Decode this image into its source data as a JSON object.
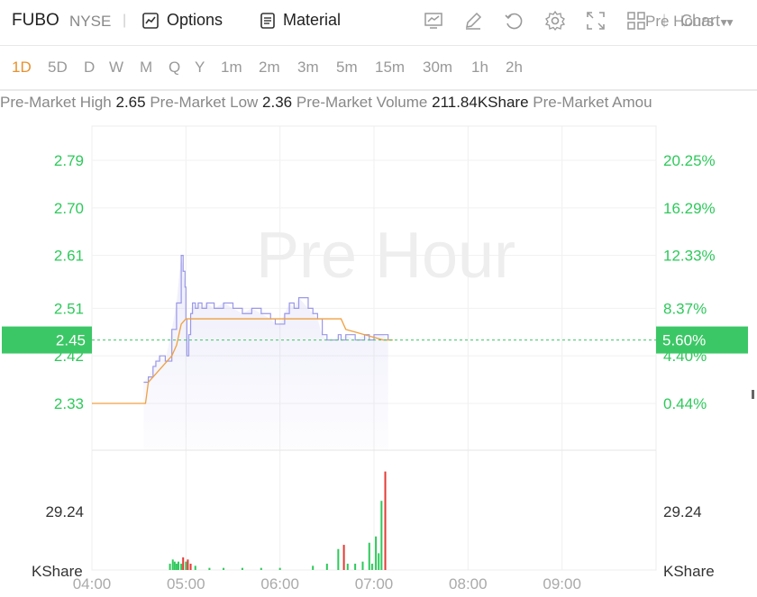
{
  "header": {
    "symbol": "FUBO",
    "exchange": "NYSE",
    "options_label": "Options",
    "material_label": "Material",
    "chart_select_label": "Chart",
    "icons": [
      "line-chart-icon",
      "pen-icon",
      "undo-icon",
      "settings-icon",
      "fullscreen-icon",
      "grid-layout-icon"
    ]
  },
  "periods": [
    "1D",
    "5D",
    "D",
    "W",
    "M",
    "Q",
    "Y",
    "1m",
    "2m",
    "3m",
    "5m",
    "15m",
    "30m",
    "1h",
    "2h"
  ],
  "active_period": "1D",
  "session_select_label": "Pre Hours",
  "stats": [
    {
      "label": "Pre-Market High",
      "value": "2.65"
    },
    {
      "label": "Pre-Market Low",
      "value": "2.36"
    },
    {
      "label": "Pre-Market Volume",
      "value": "211.84KShare"
    },
    {
      "label": "Pre-Market Amou",
      "value": ""
    }
  ],
  "colors": {
    "up": "#2ec95b",
    "down": "#e53935",
    "price_line": "#9a98e8",
    "avg_line": "#f0a040",
    "current": "#3cc766"
  },
  "chart_data": {
    "type": "line",
    "watermark": "Pre Hour",
    "x_ticks": [
      "04:00",
      "05:00",
      "06:00",
      "07:00",
      "08:00",
      "09:00"
    ],
    "x_range_hours": [
      4.0,
      10.0
    ],
    "price_ticks": [
      "2.79",
      "2.70",
      "2.61",
      "2.51",
      "2.42",
      "2.33"
    ],
    "price_tick_values": [
      2.79,
      2.7,
      2.61,
      2.51,
      2.42,
      2.33
    ],
    "pct_ticks": [
      "20.25%",
      "16.29%",
      "12.33%",
      "8.37%",
      "4.40%",
      "0.44%"
    ],
    "ylim": [
      2.3,
      2.82
    ],
    "current_price": "2.45",
    "current_pct": "5.60%",
    "current_value": 2.45,
    "price_series": {
      "x": [
        4.55,
        4.6,
        4.65,
        4.68,
        4.72,
        4.78,
        4.85,
        4.9,
        4.95,
        4.97,
        4.99,
        5.0,
        5.01,
        5.03,
        5.05,
        5.07,
        5.1,
        5.13,
        5.17,
        5.22,
        5.3,
        5.4,
        5.5,
        5.6,
        5.7,
        5.8,
        5.9,
        5.95,
        6.0,
        6.05,
        6.1,
        6.15,
        6.2,
        6.3,
        6.35,
        6.4,
        6.45,
        6.5,
        6.6,
        6.62,
        6.65,
        6.7,
        6.8,
        6.9,
        6.95,
        7.0,
        7.1,
        7.15
      ],
      "y": [
        2.37,
        2.38,
        2.4,
        2.41,
        2.42,
        2.41,
        2.47,
        2.52,
        2.61,
        2.58,
        2.55,
        2.49,
        2.42,
        2.46,
        2.5,
        2.52,
        2.51,
        2.52,
        2.51,
        2.52,
        2.51,
        2.52,
        2.51,
        2.5,
        2.51,
        2.5,
        2.49,
        2.48,
        2.48,
        2.5,
        2.52,
        2.51,
        2.53,
        2.51,
        2.5,
        2.49,
        2.46,
        2.45,
        2.45,
        2.46,
        2.45,
        2.46,
        2.45,
        2.46,
        2.45,
        2.46,
        2.46,
        2.45
      ]
    },
    "avg_series": {
      "x": [
        4.0,
        4.57,
        4.6,
        4.65,
        4.7,
        4.8,
        4.85,
        4.9,
        4.95,
        5.0,
        5.2,
        5.5,
        5.8,
        6.0,
        6.3,
        6.5,
        6.65,
        6.7,
        6.8,
        6.9,
        7.0,
        7.1,
        7.2
      ],
      "y": [
        2.33,
        2.33,
        2.37,
        2.38,
        2.39,
        2.41,
        2.42,
        2.44,
        2.48,
        2.49,
        2.49,
        2.49,
        2.49,
        2.49,
        2.49,
        2.49,
        2.49,
        2.47,
        2.465,
        2.46,
        2.455,
        2.45,
        2.45
      ]
    },
    "volume": {
      "unit_label": "KShare",
      "tick_label": "29.24",
      "bars": [
        {
          "t": 4.83,
          "v": 3,
          "dir": "up"
        },
        {
          "t": 4.86,
          "v": 5,
          "dir": "up"
        },
        {
          "t": 4.88,
          "v": 4,
          "dir": "up"
        },
        {
          "t": 4.9,
          "v": 3,
          "dir": "up"
        },
        {
          "t": 4.92,
          "v": 4,
          "dir": "up"
        },
        {
          "t": 4.95,
          "v": 3,
          "dir": "up"
        },
        {
          "t": 4.97,
          "v": 6,
          "dir": "down"
        },
        {
          "t": 5.0,
          "v": 4,
          "dir": "up"
        },
        {
          "t": 5.02,
          "v": 5,
          "dir": "down"
        },
        {
          "t": 5.05,
          "v": 3,
          "dir": "down"
        },
        {
          "t": 5.1,
          "v": 2,
          "dir": "up"
        },
        {
          "t": 5.25,
          "v": 1,
          "dir": "up"
        },
        {
          "t": 5.4,
          "v": 1,
          "dir": "up"
        },
        {
          "t": 5.6,
          "v": 1,
          "dir": "up"
        },
        {
          "t": 5.8,
          "v": 1,
          "dir": "up"
        },
        {
          "t": 6.0,
          "v": 1,
          "dir": "up"
        },
        {
          "t": 6.35,
          "v": 2,
          "dir": "up"
        },
        {
          "t": 6.5,
          "v": 3,
          "dir": "up"
        },
        {
          "t": 6.62,
          "v": 10,
          "dir": "up"
        },
        {
          "t": 6.68,
          "v": 12,
          "dir": "down"
        },
        {
          "t": 6.72,
          "v": 3,
          "dir": "up"
        },
        {
          "t": 6.8,
          "v": 3,
          "dir": "up"
        },
        {
          "t": 6.88,
          "v": 4,
          "dir": "up"
        },
        {
          "t": 6.95,
          "v": 13,
          "dir": "up"
        },
        {
          "t": 6.98,
          "v": 3,
          "dir": "up"
        },
        {
          "t": 7.02,
          "v": 16,
          "dir": "up"
        },
        {
          "t": 7.05,
          "v": 8,
          "dir": "up"
        },
        {
          "t": 7.08,
          "v": 33,
          "dir": "up"
        },
        {
          "t": 7.12,
          "v": 47,
          "dir": "down"
        }
      ]
    }
  }
}
